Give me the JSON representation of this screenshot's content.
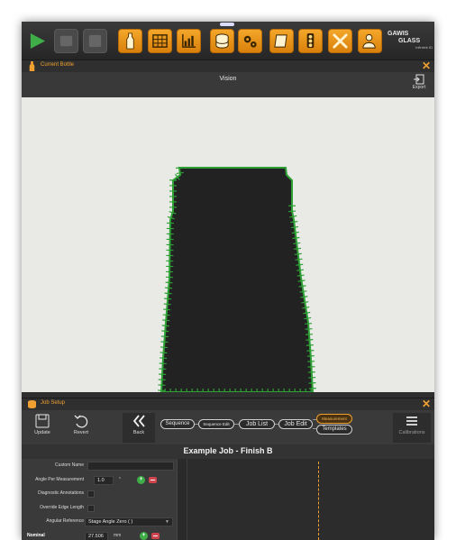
{
  "toolbar": {
    "buttons": [
      {
        "name": "play-button",
        "icon": "play-icon",
        "style": "green"
      },
      {
        "name": "pause-button",
        "icon": "pause-icon",
        "style": "gray"
      },
      {
        "name": "stop-button",
        "icon": "stop-icon",
        "style": "gray"
      },
      {
        "name": "bottle-button",
        "icon": "bottle-icon",
        "style": "orange"
      },
      {
        "name": "table-button",
        "icon": "table-icon",
        "style": "orange"
      },
      {
        "name": "chart-button",
        "icon": "chart-icon",
        "style": "orange"
      },
      {
        "name": "database-button",
        "icon": "database-icon",
        "style": "orange"
      },
      {
        "name": "gears-button",
        "icon": "gears-icon",
        "style": "orange"
      },
      {
        "name": "notebook-button",
        "icon": "notebook-icon",
        "style": "orange"
      },
      {
        "name": "traffic-light-button",
        "icon": "traffic-light-icon",
        "style": "orange"
      },
      {
        "name": "tools-button",
        "icon": "wrench-screwdriver-icon",
        "style": "orange"
      },
      {
        "name": "user-settings-button",
        "icon": "user-gear-icon",
        "style": "orange"
      }
    ],
    "logo": {
      "line1": "GAWIS",
      "line2": "GLASS",
      "line3": "Infinitek ID"
    }
  },
  "current_bottle": {
    "title": "Current Bottle"
  },
  "vision": {
    "title": "Vision",
    "export_label": "Export"
  },
  "job_setup": {
    "title": "Job Setup",
    "buttons": {
      "update": "Update",
      "revert": "Revert",
      "back": "Back",
      "calibrations": "Calibrations"
    },
    "breadcrumbs": {
      "sequence": "Sequence",
      "sequence_edit": "Sequence Edit",
      "job_list": "Job List",
      "job_edit": "Job Edit",
      "measurement": "Measurement",
      "templates": "Templates"
    },
    "job_title": "Example Job  -  Finish B",
    "form": {
      "custom_name_label": "Custom Name",
      "custom_name_value": "",
      "angle_label": "Angle Per Measurement",
      "angle_value": "1.0",
      "angle_unit": "°",
      "diagnostic_label": "Diagnostic Annotations",
      "override_label": "Override Edge Length",
      "angular_ref_label": "Angular Reference",
      "angular_ref_value": "Stage Angle Zero ( )",
      "nominal_label": "Nominal",
      "nominal_value": "27.506",
      "nominal_unit": "mm"
    }
  },
  "colors": {
    "accent": "#f0a030",
    "toolbar_orange": "#e8951a",
    "play_green": "#3fae49",
    "edge_green": "#2ea036",
    "background": "#2e2e2e"
  }
}
